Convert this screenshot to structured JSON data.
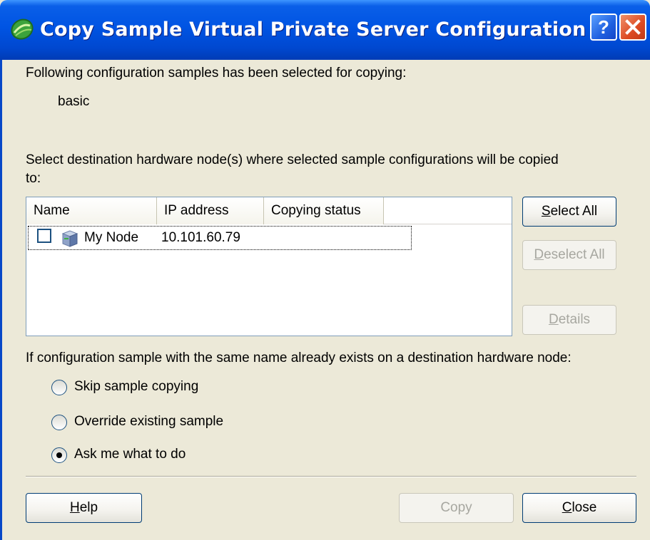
{
  "window": {
    "title": "Copy Sample Virtual Private Server Configuration",
    "help_glyph": "?",
    "close_glyph": "X"
  },
  "intro": {
    "text": "Following configuration samples has been selected for copying:",
    "samples": [
      "basic"
    ]
  },
  "destination": {
    "line1": "Select destination hardware node(s) where selected sample configurations will be copied",
    "line2": "to:"
  },
  "list": {
    "columns": [
      "Name",
      "IP address",
      "Copying status"
    ],
    "rows": [
      {
        "checked": false,
        "name": "My Node",
        "ip": "10.101.60.79",
        "status": ""
      }
    ]
  },
  "side_buttons": {
    "select_all": {
      "mnemonic": "S",
      "rest": "elect All",
      "enabled": true
    },
    "deselect_all": {
      "mnemonic": "D",
      "rest": "eselect All",
      "enabled": false
    },
    "details": {
      "mnemonic": "D",
      "rest": "etails",
      "enabled": false
    }
  },
  "conflict": {
    "question": "If configuration sample with the same name already exists on a destination hardware node:",
    "options": [
      {
        "label": "Skip sample copying",
        "selected": false
      },
      {
        "label": "Override existing sample",
        "selected": false
      },
      {
        "label": "Ask me what to do",
        "selected": true
      }
    ]
  },
  "footer_buttons": {
    "help": {
      "mnemonic": "H",
      "rest": "elp",
      "enabled": true
    },
    "copy": {
      "label": "Copy",
      "enabled": false
    },
    "close": {
      "mnemonic": "C",
      "rest": "lose",
      "enabled": true
    }
  },
  "colors": {
    "titlebar": "#0054E3",
    "dialog_bg": "#ECE9D8",
    "close_button": "#DC4A22",
    "disabled_text": "#A7A7A0"
  },
  "icons": {
    "title": "green-globe-icon",
    "node": "server-icon"
  }
}
